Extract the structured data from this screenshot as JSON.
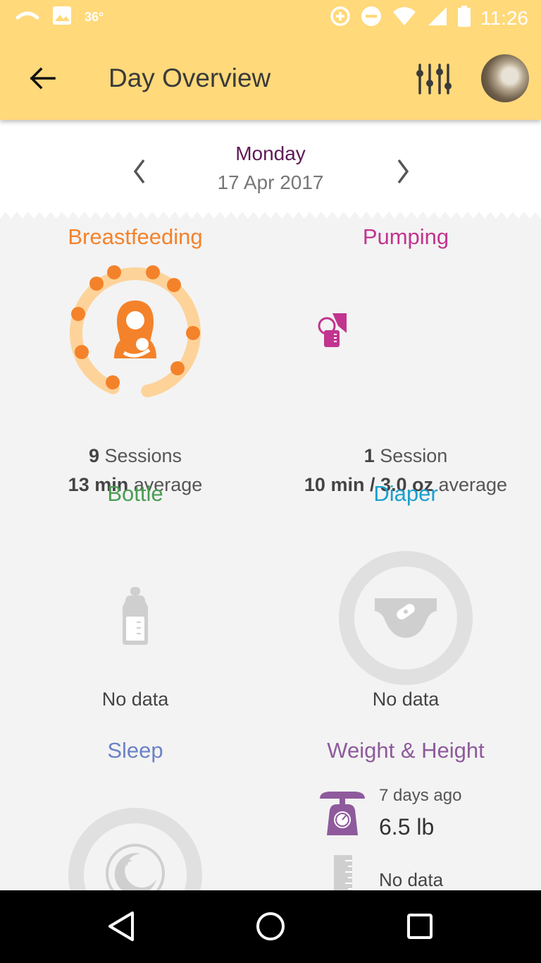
{
  "status_bar": {
    "temperature": "36°",
    "time": "11:26",
    "icons": [
      "wifi-calling-icon",
      "image-icon",
      "data-saver-icon",
      "do-not-disturb-icon",
      "wifi-icon",
      "signal-icon",
      "battery-icon"
    ]
  },
  "app_bar": {
    "title": "Day Overview",
    "back_icon": "arrow-left-icon",
    "filter_icon": "sliders-icon",
    "avatar": "profile-photo"
  },
  "date_nav": {
    "day": "Monday",
    "date": "17 Apr 2017"
  },
  "sections": {
    "breastfeeding": {
      "title": "Breastfeeding",
      "sessions_count": "9",
      "sessions_label": "Sessions",
      "average_value": "13 min",
      "average_label": "average",
      "color": "#f4822a",
      "ring_color": "#fdd39a"
    },
    "pumping": {
      "title": "Pumping",
      "sessions_count": "1",
      "sessions_label": "Session",
      "average_value": "10 min / 3.0 oz",
      "average_label": "average",
      "color": "#c2348f"
    },
    "bottle": {
      "title": "Bottle",
      "status": "No data",
      "color": "#4a9e52"
    },
    "diaper": {
      "title": "Diaper",
      "status": "No data",
      "color": "#1a9fcf"
    },
    "sleep": {
      "title": "Sleep",
      "color": "#6c82c7"
    },
    "weight_height": {
      "title": "Weight & Height",
      "weight_when": "7 days ago",
      "weight_value": "6.5 lb",
      "height_status": "No data",
      "color": "#8e5a9c"
    }
  },
  "nav_bar": {
    "buttons": [
      "back-triangle-icon",
      "home-circle-icon",
      "recents-square-icon"
    ]
  }
}
